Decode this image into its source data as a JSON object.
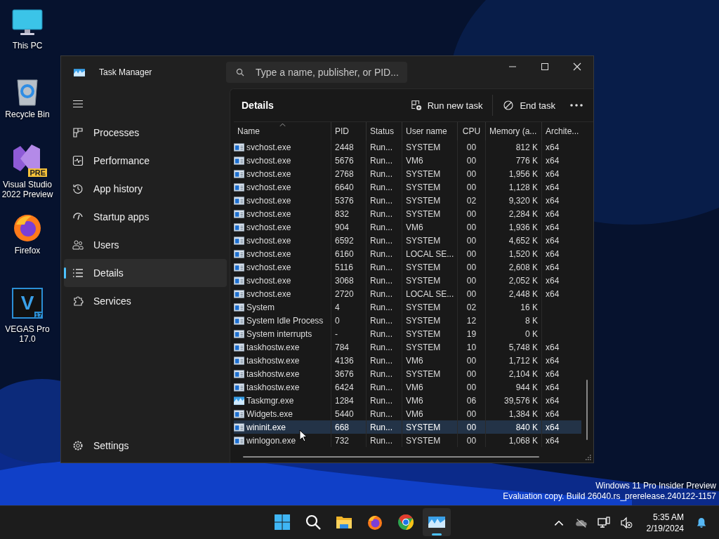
{
  "desktop_icons": [
    {
      "kind": "computer",
      "label": "This PC"
    },
    {
      "kind": "recycle",
      "label": "Recycle Bin"
    },
    {
      "kind": "vs",
      "label": "Visual Studio 2022 Preview",
      "badge": "PRE"
    },
    {
      "kind": "firefox",
      "label": "Firefox"
    },
    {
      "kind": "vegas",
      "label": "VEGAS Pro 17.0",
      "glyph": "V",
      "badge": "17"
    }
  ],
  "window": {
    "title": "Task Manager",
    "search": {
      "placeholder": "Type a name, publisher, or PID..."
    },
    "nav": [
      {
        "kind": "processes",
        "label": "Processes",
        "selected": false
      },
      {
        "kind": "performance",
        "label": "Performance",
        "selected": false
      },
      {
        "kind": "history",
        "label": "App history",
        "selected": false
      },
      {
        "kind": "startup",
        "label": "Startup apps",
        "selected": false
      },
      {
        "kind": "users",
        "label": "Users",
        "selected": false
      },
      {
        "kind": "details",
        "label": "Details",
        "selected": true
      },
      {
        "kind": "services",
        "label": "Services",
        "selected": false
      }
    ],
    "settings": "Settings",
    "page_title": "Details",
    "toolbar": [
      {
        "kind": "run",
        "label": "Run new task"
      },
      {
        "kind": "end",
        "label": "End task"
      },
      {
        "kind": "more"
      }
    ],
    "table": {
      "columns": [
        {
          "label": "Name",
          "sorted": true
        },
        {
          "label": "PID",
          "sorted": false
        },
        {
          "label": "Status",
          "sorted": false
        },
        {
          "label": "User name",
          "sorted": false
        },
        {
          "label": "CPU",
          "sorted": false
        },
        {
          "label": "Memory (a...",
          "sorted": false
        },
        {
          "label": "Archite...",
          "sorted": false
        }
      ],
      "rows": [
        {
          "kind": "app",
          "cells": [
            "svchost.exe",
            "2448",
            "Run...",
            "SYSTEM",
            "00",
            "812 K",
            "x64"
          ],
          "selected": false
        },
        {
          "kind": "app",
          "cells": [
            "svchost.exe",
            "5676",
            "Run...",
            "VM6",
            "00",
            "776 K",
            "x64"
          ],
          "selected": false
        },
        {
          "kind": "app",
          "cells": [
            "svchost.exe",
            "2768",
            "Run...",
            "SYSTEM",
            "00",
            "1,956 K",
            "x64"
          ],
          "selected": false
        },
        {
          "kind": "app",
          "cells": [
            "svchost.exe",
            "6640",
            "Run...",
            "SYSTEM",
            "00",
            "1,128 K",
            "x64"
          ],
          "selected": false
        },
        {
          "kind": "app",
          "cells": [
            "svchost.exe",
            "5376",
            "Run...",
            "SYSTEM",
            "02",
            "9,320 K",
            "x64"
          ],
          "selected": false
        },
        {
          "kind": "app",
          "cells": [
            "svchost.exe",
            "832",
            "Run...",
            "SYSTEM",
            "00",
            "2,284 K",
            "x64"
          ],
          "selected": false
        },
        {
          "kind": "app",
          "cells": [
            "svchost.exe",
            "904",
            "Run...",
            "VM6",
            "00",
            "1,936 K",
            "x64"
          ],
          "selected": false
        },
        {
          "kind": "app",
          "cells": [
            "svchost.exe",
            "6592",
            "Run...",
            "SYSTEM",
            "00",
            "4,652 K",
            "x64"
          ],
          "selected": false
        },
        {
          "kind": "app",
          "cells": [
            "svchost.exe",
            "6160",
            "Run...",
            "LOCAL SE...",
            "00",
            "1,520 K",
            "x64"
          ],
          "selected": false
        },
        {
          "kind": "app",
          "cells": [
            "svchost.exe",
            "5116",
            "Run...",
            "SYSTEM",
            "00",
            "2,608 K",
            "x64"
          ],
          "selected": false
        },
        {
          "kind": "app",
          "cells": [
            "svchost.exe",
            "3068",
            "Run...",
            "SYSTEM",
            "00",
            "2,052 K",
            "x64"
          ],
          "selected": false
        },
        {
          "kind": "app",
          "cells": [
            "svchost.exe",
            "2720",
            "Run...",
            "LOCAL SE...",
            "00",
            "2,448 K",
            "x64"
          ],
          "selected": false
        },
        {
          "kind": "app",
          "cells": [
            "System",
            "4",
            "Run...",
            "SYSTEM",
            "02",
            "16 K",
            ""
          ],
          "selected": false
        },
        {
          "kind": "app",
          "cells": [
            "System Idle Process",
            "0",
            "Run...",
            "SYSTEM",
            "12",
            "8 K",
            ""
          ],
          "selected": false
        },
        {
          "kind": "app",
          "cells": [
            "System interrupts",
            "-",
            "Run...",
            "SYSTEM",
            "19",
            "0 K",
            ""
          ],
          "selected": false
        },
        {
          "kind": "app",
          "cells": [
            "taskhostw.exe",
            "784",
            "Run...",
            "SYSTEM",
            "10",
            "5,748 K",
            "x64"
          ],
          "selected": false
        },
        {
          "kind": "app",
          "cells": [
            "taskhostw.exe",
            "4136",
            "Run...",
            "VM6",
            "00",
            "1,712 K",
            "x64"
          ],
          "selected": false
        },
        {
          "kind": "app",
          "cells": [
            "taskhostw.exe",
            "3676",
            "Run...",
            "SYSTEM",
            "00",
            "2,104 K",
            "x64"
          ],
          "selected": false
        },
        {
          "kind": "app",
          "cells": [
            "taskhostw.exe",
            "6424",
            "Run...",
            "VM6",
            "00",
            "944 K",
            "x64"
          ],
          "selected": false
        },
        {
          "kind": "taskmgr",
          "cells": [
            "Taskmgr.exe",
            "1284",
            "Run...",
            "VM6",
            "06",
            "39,576 K",
            "x64"
          ],
          "selected": false
        },
        {
          "kind": "app",
          "cells": [
            "Widgets.exe",
            "5440",
            "Run...",
            "VM6",
            "00",
            "1,384 K",
            "x64"
          ],
          "selected": false
        },
        {
          "kind": "app",
          "cells": [
            "wininit.exe",
            "668",
            "Run...",
            "SYSTEM",
            "00",
            "840 K",
            "x64"
          ],
          "selected": true
        },
        {
          "kind": "app",
          "cells": [
            "winlogon.exe",
            "732",
            "Run...",
            "SYSTEM",
            "00",
            "1,068 K",
            "x64"
          ],
          "selected": false
        }
      ]
    }
  },
  "evaluation_notice": [
    "Windows 11 Pro Insider Preview",
    "Evaluation copy. Build 26040.rs_prerelease.240122-1157"
  ],
  "taskbar": {
    "apps": [
      {
        "kind": "start",
        "selected": false
      },
      {
        "kind": "search",
        "selected": false
      },
      {
        "kind": "explorer",
        "selected": false
      },
      {
        "kind": "firefox",
        "selected": false
      },
      {
        "kind": "chrome",
        "selected": false
      },
      {
        "kind": "taskmgr",
        "selected": true
      }
    ],
    "tray": [
      {
        "kind": "chevron"
      },
      {
        "kind": "cloud"
      },
      {
        "kind": "network"
      },
      {
        "kind": "volume"
      }
    ],
    "time": "5:35 AM",
    "date": "2/19/2024"
  }
}
